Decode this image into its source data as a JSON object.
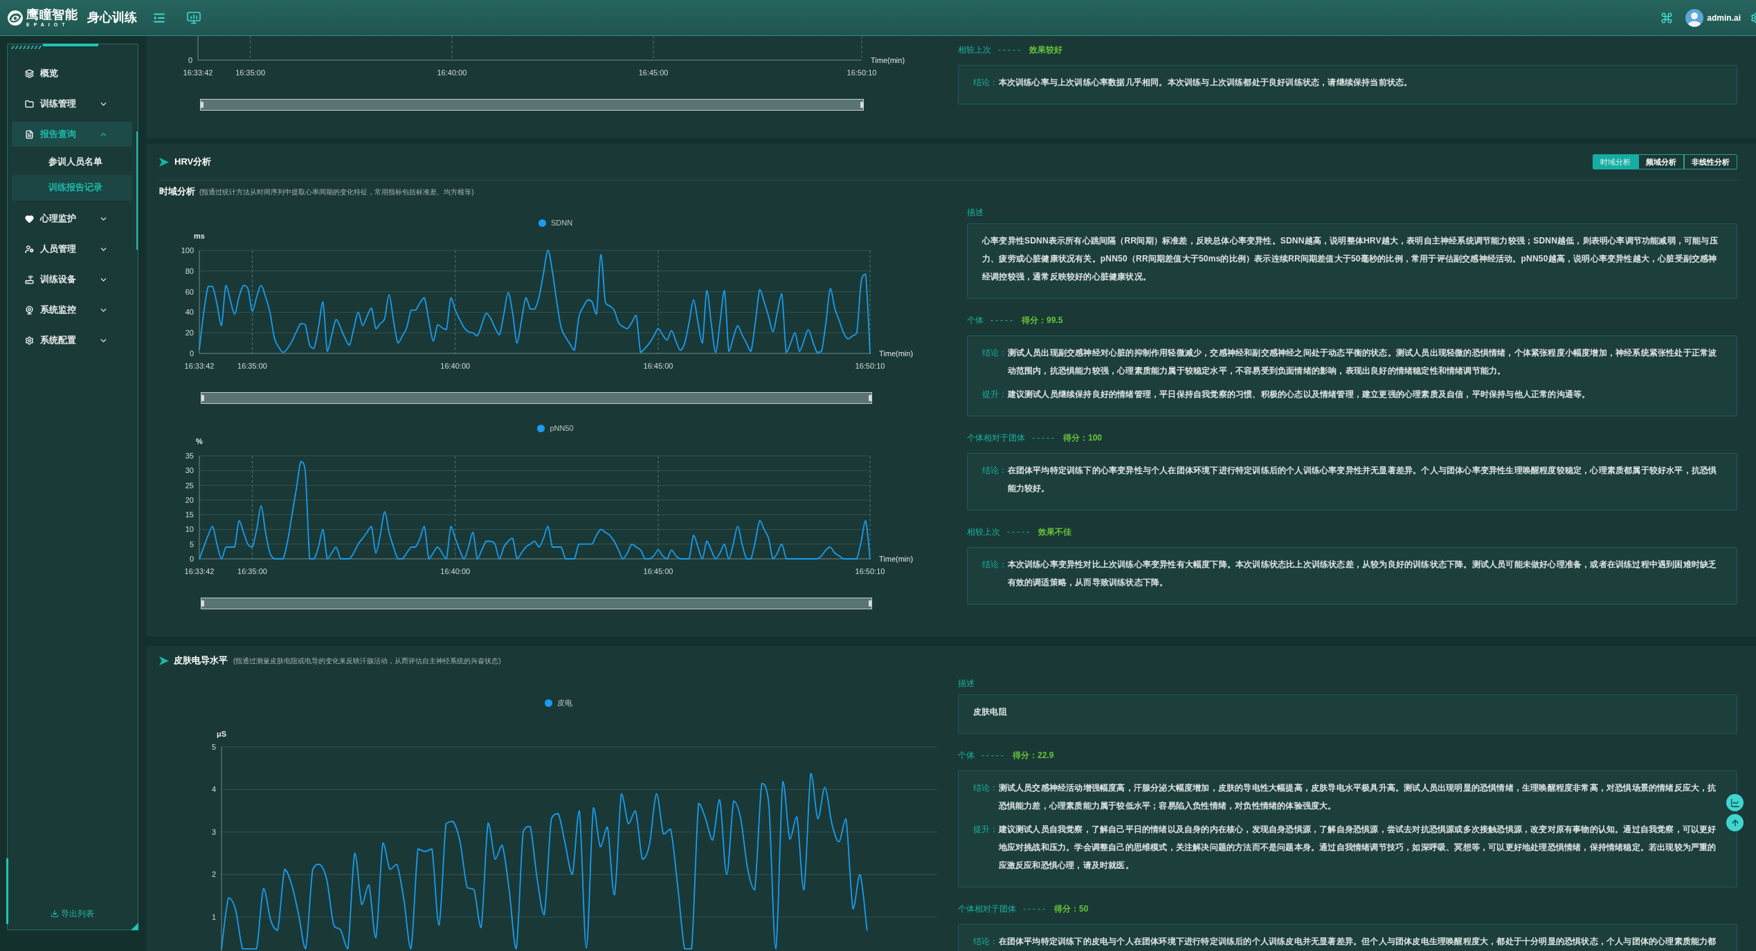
{
  "header": {
    "brand": "鹰瞳智能",
    "brand_subtitle": "EPAIOT",
    "title": "身心训练",
    "user": "admin.ai"
  },
  "sidebar": {
    "items": [
      {
        "kind": "link",
        "label": "概览",
        "selected": false
      },
      {
        "kind": "group",
        "label": "训练管理",
        "selected": false,
        "expanded": false
      },
      {
        "kind": "group",
        "label": "报告查询",
        "selected": true,
        "expanded": true,
        "children": [
          {
            "label": "参训人员名单",
            "selected": false
          },
          {
            "label": "训练报告记录",
            "selected": true
          }
        ]
      },
      {
        "kind": "group",
        "label": "心理监护",
        "selected": false,
        "expanded": false
      },
      {
        "kind": "group",
        "label": "人员管理",
        "selected": false,
        "expanded": false
      },
      {
        "kind": "group",
        "label": "训练设备",
        "selected": false,
        "expanded": false
      },
      {
        "kind": "group",
        "label": "系统监控",
        "selected": false,
        "expanded": false
      },
      {
        "kind": "group",
        "label": "系统配置",
        "selected": false,
        "expanded": false
      }
    ],
    "export_label": "导出列表"
  },
  "heart_rate": {
    "chart_tail": {
      "y_tick_label": "0",
      "x_tick_labels": [
        "16:33:42",
        "16:35:00",
        "16:40:00",
        "16:45:00",
        "16:50:10"
      ],
      "x_axis_title": "Time(min)"
    },
    "slider": {
      "level": 1
    },
    "comparison": {
      "label": "相较上次",
      "separator": "-----",
      "result": "效果较好",
      "notes": [
        {
          "label": "结论：",
          "text": "本次训练心率与上次训练心率数据几乎相同。本次训练与上次训练都处于良好训练状态，请继续保持当前状态。"
        }
      ]
    }
  },
  "hrv": {
    "title": "HRV分析",
    "tabs": [
      {
        "label": "时域分析",
        "selected": true
      },
      {
        "label": "频域分析",
        "selected": false
      },
      {
        "label": "非线性分析",
        "selected": false
      }
    ],
    "subtitle": "时域分析",
    "subtitle_note": "(指通过统计方法从时间序列中提取心率间期的变化特征，常用指标包括标准差、均方根等)",
    "charts": [
      {
        "chart_data": {
          "type": "line",
          "grid": true,
          "xlabel": "Time(min)",
          "ylabel": "ms",
          "categories": [
            "16:33:42",
            null,
            null,
            null,
            null,
            null,
            null,
            null,
            null,
            null,
            null,
            null,
            "16:35:00",
            null,
            null,
            null,
            null,
            null,
            null,
            null,
            null,
            null,
            null,
            null,
            null,
            null,
            null,
            null,
            null,
            null,
            null,
            null,
            null,
            null,
            null,
            null,
            null,
            null,
            null,
            null,
            null,
            null,
            null,
            null,
            null,
            null,
            null,
            null,
            null,
            null,
            null,
            null,
            null,
            null,
            null,
            null,
            null,
            null,
            "16:40:00",
            null,
            null,
            null,
            null,
            null,
            null,
            null,
            null,
            null,
            null,
            null,
            null,
            null,
            null,
            null,
            null,
            null,
            null,
            null,
            null,
            null,
            null,
            null,
            null,
            null,
            null,
            null,
            null,
            null,
            null,
            null,
            null,
            null,
            null,
            null,
            null,
            null,
            null,
            null,
            null,
            null,
            null,
            null,
            null,
            null,
            "16:45:00",
            null,
            null,
            null,
            null,
            null,
            null,
            null,
            null,
            null,
            null,
            null,
            null,
            null,
            null,
            null,
            null,
            null,
            null,
            null,
            null,
            null,
            null,
            null,
            null,
            null,
            null,
            null,
            null,
            null,
            null,
            null,
            null,
            null,
            null,
            null,
            null,
            null,
            null,
            null,
            null,
            null,
            null,
            null,
            null,
            null,
            null,
            null,
            "16:50:10"
          ],
          "series": [
            {
              "name": "SDNN",
              "color": "#1a9cf0",
              "values": [
                4,
                40,
                65,
                65,
                48,
                27,
                66,
                52,
                38,
                55,
                66,
                63,
                41,
                55,
                66,
                55,
                40,
                15,
                6,
                1,
                5,
                12,
                21,
                29,
                28,
                8,
                5,
                25,
                50,
                2,
                18,
                33,
                25,
                15,
                8,
                24,
                40,
                27,
                36,
                44,
                24,
                29,
                34,
                57,
                32,
                10,
                17,
                25,
                42,
                42,
                49,
                54,
                32,
                12,
                28,
                25,
                23,
                54,
                42,
                33,
                25,
                21,
                20,
                17,
                28,
                39,
                34,
                25,
                18,
                38,
                59,
                39,
                10,
                32,
                54,
                43,
                43,
                55,
                78,
                100,
                80,
                50,
                25,
                16,
                9,
                3,
                35,
                45,
                52,
                50,
                38,
                96,
                50,
                46,
                42,
                30,
                26,
                24,
                30,
                37,
                1,
                5,
                10,
                17,
                24,
                18,
                13,
                22,
                12,
                3,
                10,
                30,
                52,
                30,
                10,
                61,
                30,
                1,
                30,
                61,
                2,
                15,
                27,
                18,
                10,
                2,
                30,
                62,
                50,
                36,
                21,
                40,
                58,
                1,
                10,
                20,
                2,
                12,
                23,
                12,
                1,
                2,
                30,
                63,
                44,
                32,
                20,
                14,
                17,
                20,
                70,
                77,
                0
              ]
            }
          ],
          "ylim": [
            0,
            100
          ],
          "yticks": [
            0,
            20,
            40,
            60,
            80,
            100
          ]
        },
        "slider": {
          "level": 1
        }
      },
      {
        "chart_data": {
          "type": "line",
          "grid": true,
          "xlabel": "Time(min)",
          "ylabel": "%",
          "categories": [
            "16:33:42",
            null,
            null,
            null,
            null,
            null,
            null,
            null,
            null,
            null,
            null,
            null,
            "16:35:00",
            null,
            null,
            null,
            null,
            null,
            null,
            null,
            null,
            null,
            null,
            null,
            null,
            null,
            null,
            null,
            null,
            null,
            null,
            null,
            null,
            null,
            null,
            null,
            null,
            null,
            null,
            null,
            null,
            null,
            null,
            null,
            null,
            null,
            null,
            null,
            null,
            null,
            null,
            null,
            null,
            null,
            null,
            null,
            null,
            null,
            "16:40:00",
            null,
            null,
            null,
            null,
            null,
            null,
            null,
            null,
            null,
            null,
            null,
            null,
            null,
            null,
            null,
            null,
            null,
            null,
            null,
            null,
            null,
            null,
            null,
            null,
            null,
            null,
            null,
            null,
            null,
            null,
            null,
            null,
            null,
            null,
            null,
            null,
            null,
            null,
            null,
            null,
            null,
            null,
            null,
            null,
            null,
            "16:45:00",
            null,
            null,
            null,
            null,
            null,
            null,
            null,
            null,
            null,
            null,
            null,
            null,
            null,
            null,
            null,
            null,
            null,
            null,
            null,
            null,
            null,
            null,
            null,
            null,
            null,
            null,
            null,
            null,
            null,
            null,
            null,
            null,
            null,
            null,
            null,
            null,
            null,
            null,
            null,
            null,
            null,
            null,
            null,
            null,
            null,
            null,
            null,
            "16:50:10"
          ],
          "series": [
            {
              "name": "pNN50",
              "color": "#1a9cf0",
              "values": [
                0,
                4,
                8,
                11,
                5,
                0,
                4,
                4,
                4,
                13,
                9,
                5,
                4,
                10,
                18,
                9,
                2,
                0,
                0,
                0,
                6,
                15,
                24,
                33,
                30,
                0,
                0,
                4,
                10,
                0,
                2,
                4,
                0,
                0,
                0,
                2,
                5,
                7,
                9,
                11,
                2,
                8,
                16,
                9,
                4,
                0,
                0,
                2,
                4,
                4,
                7,
                11,
                0,
                2,
                4,
                2,
                0,
                11,
                7,
                3,
                0,
                4,
                9,
                0,
                3,
                6,
                6,
                5,
                0,
                4,
                6,
                7,
                0,
                2,
                4,
                5,
                6,
                4,
                7,
                11,
                4,
                4,
                4,
                0,
                0,
                0,
                5,
                5,
                5,
                5,
                8,
                10,
                9,
                8,
                6,
                3,
                0,
                2,
                5,
                4,
                3,
                0,
                0,
                1,
                3,
                1,
                0,
                3,
                1,
                0,
                0,
                0,
                8,
                4,
                0,
                6,
                3,
                0,
                2,
                5,
                0,
                5,
                11,
                5,
                0,
                0,
                6,
                13,
                10,
                7,
                0,
                2,
                5,
                0,
                0,
                0,
                0,
                0,
                0,
                0,
                0,
                1,
                3,
                4,
                2,
                1,
                0,
                0,
                0,
                0,
                6,
                13,
                0
              ]
            }
          ],
          "ylim": [
            0,
            35
          ],
          "yticks": [
            0,
            5,
            10,
            15,
            20,
            25,
            30,
            35
          ]
        },
        "slider": {
          "level": 1
        }
      }
    ],
    "description_label": "描述",
    "description": "心率变异性SDNN表示所有心跳间隔（RR间期）标准差，反映总体心率变异性。SDNN越高，说明整体HRV越大，表明自主神经系统调节能力较强；SDNN越低，则表明心率调节功能减弱，可能与压力、疲劳或心脏健康状况有关。pNN50（RR间期差值大于50ms的比例）表示连续RR间期差值大于50毫秒的比例，常用于评估副交感神经活动。pNN50越高，说明心率变异性越大，心脏受副交感神经调控较强，通常反映较好的心脏健康状况。",
    "assessments": [
      {
        "label": "个体",
        "separator": "-----",
        "result": "得分：99.5",
        "notes": [
          {
            "label": "结论：",
            "text": "测试人员出现副交感神经对心脏的抑制作用轻微减少，交感神经和副交感神经之间处于动态平衡的状态。测试人员出现轻微的恐惧情绪，个体紧张程度小幅度增加，神经系统紧张性处于正常波动范围内，抗恐惧能力较强，心理素质能力属于较稳定水平，不容易受到负面情绪的影响，表现出良好的情绪稳定性和情绪调节能力。"
          },
          {
            "label": "提升：",
            "text": "建议测试人员继续保持良好的情绪管理，平日保持自我觉察的习惯、积极的心态以及情绪管理，建立更强的心理素质及自信，平时保持与他人正常的沟通等。"
          }
        ]
      },
      {
        "label": "个体相对于团体",
        "separator": "-----",
        "result": "得分：100",
        "notes": [
          {
            "label": "结论：",
            "text": "在团体平均特定训练下的心率变异性与个人在团体环境下进行特定训练后的个人训练心率变异性并无显著差异。个人与团体心率变异性生理唤醒程度较稳定，心理素质都属于较好水平，抗恐惧能力较好。"
          }
        ]
      },
      {
        "label": "相较上次",
        "separator": "-----",
        "result": "效果不佳",
        "notes": [
          {
            "label": "结论：",
            "text": "本次训练心率变异性对比上次训练心率变异性有大幅度下降。本次训练状态比上次训练状态差，从较为良好的训练状态下降。测试人员可能未做好心理准备，或者在训练过程中遇到困难时缺乏有效的调适策略，从而导致训练状态下降。"
          }
        ]
      }
    ]
  },
  "skin": {
    "title": "皮肤电导水平",
    "note": "(指通过测量皮肤电阻或电导的变化来反映汗腺活动，从而评估自主神经系统的兴奋状态)",
    "chart_data": {
      "type": "line",
      "grid": true,
      "ylabel": "μS",
      "categories": [
        null,
        null,
        null,
        null,
        null,
        null,
        null,
        null,
        null,
        null,
        null,
        null,
        null,
        null,
        null,
        null,
        null,
        null,
        null,
        null,
        null,
        null,
        null,
        null,
        null,
        null,
        null,
        null,
        null,
        null,
        null,
        null,
        null,
        null,
        null,
        null,
        null,
        null,
        null,
        null,
        null,
        null,
        null,
        null,
        null,
        null,
        null,
        null,
        null,
        null,
        null,
        null,
        null,
        null,
        null,
        null,
        null,
        null,
        null,
        null,
        null,
        null,
        null,
        null,
        null,
        null,
        null,
        null,
        null,
        null,
        null,
        null,
        null,
        null,
        null,
        null,
        null,
        null,
        null,
        null,
        null,
        null,
        null,
        null,
        null,
        null,
        null,
        null,
        null,
        null,
        null,
        null,
        null,
        null,
        null,
        null,
        null,
        null,
        null,
        null,
        null,
        null,
        null
      ],
      "series": [
        {
          "name": "皮电",
          "color": "#1a9cf0",
          "values": [
            0.25,
            1.45,
            1.17,
            0.25,
            0.25,
            0.25,
            1.67,
            0.93,
            0.69,
            2.12,
            1.76,
            1.05,
            0.25,
            2.12,
            2.24,
            1.88,
            0.81,
            0.69,
            0.25,
            2.5,
            1.29,
            1.76,
            0.51,
            2.74,
            2.12,
            2.24,
            1.4,
            0.25,
            2.6,
            2.54,
            2.6,
            0.81,
            3.19,
            3.25,
            2.77,
            1.7,
            1.64,
            0.75,
            3.21,
            2.36,
            2.69,
            1.64,
            0.25,
            3.01,
            3.13,
            1.88,
            1.05,
            3.31,
            3.43,
            2.71,
            2.0,
            3.5,
            0.27,
            3.57,
            2.65,
            3.12,
            1.52,
            3.9,
            3.19,
            3.5,
            2.36,
            2.71,
            3.9,
            2.95,
            3.07,
            1.76,
            0.25,
            0.25,
            3.67,
            3.31,
            2.81,
            3.76,
            2.0,
            3.73,
            3.31,
            2.12,
            1.64,
            4.14,
            3.67,
            0.25,
            4.19,
            2.83,
            3.36,
            1.64,
            4.38,
            3.31,
            4.05,
            3.19,
            2.77,
            3.31,
            1.19,
            2.0,
            0.69,
            null,
            null,
            null,
            null,
            null,
            null,
            null,
            null,
            null,
            null
          ]
        }
      ],
      "ylim": [
        0.2,
        5
      ],
      "yticks": [
        1,
        2,
        3,
        4,
        5
      ]
    },
    "description_label": "描述",
    "description": "皮肤电阻",
    "assessments": [
      {
        "label": "个体",
        "separator": "-----",
        "result": "得分：22.9",
        "notes": [
          {
            "label": "结论：",
            "text": "测试人员交感神经活动增强幅度高，汗腺分泌大幅度增加，皮肤的导电性大幅提高，皮肤导电水平极具升高。测试人员出现明显的恐惧情绪，生理唤醒程度非常高，对恐惧场景的情绪反应大，抗恐惧能力差，心理素质能力属于较低水平；容易陷入负性情绪，对负性情绪的体验强度大。"
          },
          {
            "label": "提升：",
            "text": "建议测试人员自我觉察，了解自己平日的情绪以及自身的内在核心，发现自身恐惧源，了解自身恐惧源，尝试去对抗恐惧源或多次接触恐惧源，改变对原有事物的认知。通过自我觉察，可以更好地应对挑战和压力。学会调整自己的思维模式，关注解决问题的方法而不是问题本身。通过自我情绪调节技巧，如深呼吸、冥想等，可以更好地处理恐惧情绪，保持情绪稳定。若出现较为严重的应激反应和恐惧心理，请及时就医。"
          }
        ]
      },
      {
        "label": "个体相对于团体",
        "separator": "-----",
        "result": "得分：50",
        "notes": [
          {
            "label": "结论：",
            "text": "在团体平均特定训练下的皮电与个人在团体环境下进行特定训练后的个人训练皮电并无显著差异。但个人与团体皮电生理唤醒程度大，都处于十分明显的恐惧状态，个人与团体的心理素质能力都"
          }
        ]
      }
    ]
  }
}
